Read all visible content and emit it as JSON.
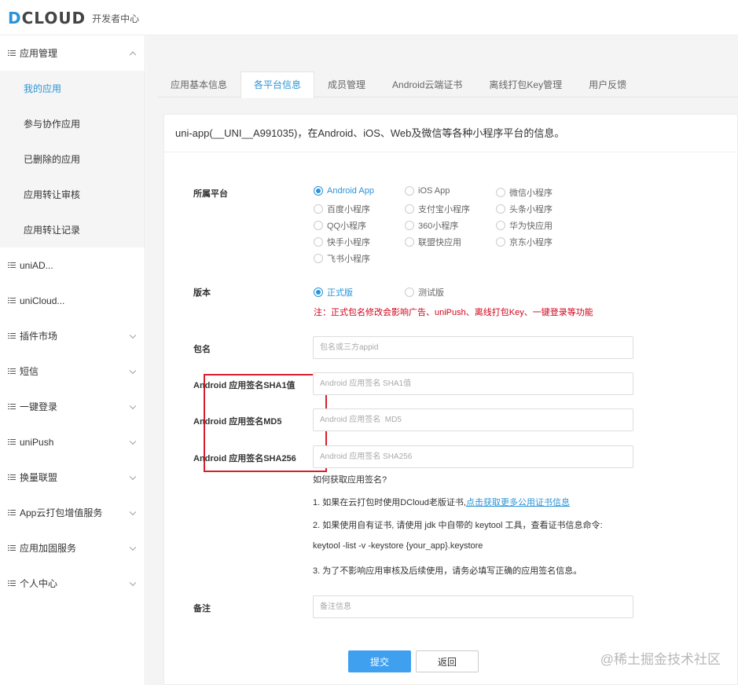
{
  "header": {
    "logo_d": "D",
    "logo_rest": "CLOUD",
    "subtitle": "开发者中心"
  },
  "sidebar": {
    "app_mgmt": "应用管理",
    "sub_items": [
      "我的应用",
      "参与协作应用",
      "已删除的应用",
      "应用转让审核",
      "应用转让记录"
    ],
    "items": [
      "uniAD...",
      "uniCloud...",
      "插件市场",
      "短信",
      "一键登录",
      "uniPush",
      "换量联盟",
      "App云打包增值服务",
      "应用加固服务",
      "个人中心"
    ]
  },
  "tabs": [
    "应用基本信息",
    "各平台信息",
    "成员管理",
    "Android云端证书",
    "离线打包Key管理",
    "用户反馈"
  ],
  "panel": {
    "title": "uni-app(__UNI__A991035)，在Android、iOS、Web及微信等各种小程序平台的信息。",
    "platform_label": "所属平台",
    "platforms": [
      "Android App",
      "iOS App",
      "微信小程序",
      "百度小程序",
      "支付宝小程序",
      "头条小程序",
      "QQ小程序",
      "360小程序",
      "华为快应用",
      "快手小程序",
      "联盟快应用",
      "京东小程序",
      "飞书小程序"
    ],
    "version_label": "版本",
    "versions": [
      "正式版",
      "测试版"
    ],
    "version_note": "注：正式包名修改会影响广告、uniPush、离线打包Key、一键登录等功能",
    "package_label": "包名",
    "package_placeholder": "包名或三方appid",
    "sha1_label": "Android 应用签名SHA1值",
    "sha1_placeholder": "Android 应用签名 SHA1值",
    "md5_label": "Android 应用签名MD5",
    "md5_placeholder": "Android 应用签名  MD5",
    "sha256_label": "Android 应用签名SHA256",
    "sha256_placeholder": "Android 应用签名 SHA256",
    "help_title": "如何获取应用签名?",
    "help_1": "1. 如果在云打包时使用DCloud老版证书,",
    "help_1_link": "点击获取更多公用证书信息",
    "help_2": "2. 如果使用自有证书, 请使用 jdk 中自带的 keytool 工具，查看证书信息命令:",
    "help_cmd": "keytool -list -v -keystore {your_app}.keystore",
    "help_3": "3. 为了不影响应用审核及后续使用，请务必填写正确的应用签名信息。",
    "remark_label": "备注",
    "remark_placeholder": "备注信息",
    "submit": "提交",
    "back": "返回"
  },
  "watermark": "@稀土掘金技术社区",
  "colors": {
    "accent": "#2b93d6",
    "primary_button": "#3fa0f0",
    "warning": "#d0021b",
    "highlight_box": "#d81e2c"
  }
}
